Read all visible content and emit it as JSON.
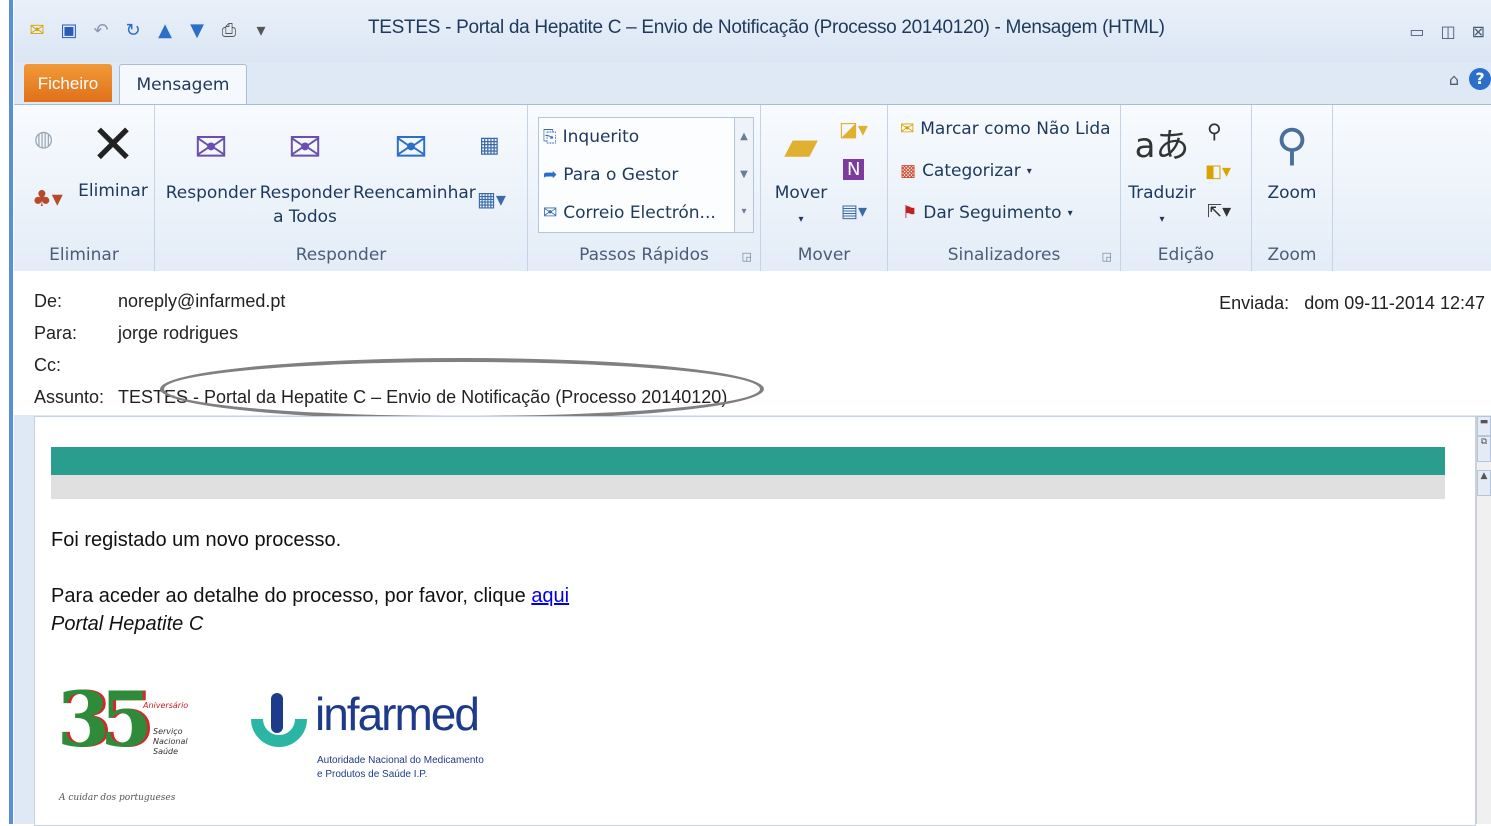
{
  "window": {
    "title": "TESTES - Portal da Hepatite C – Envio de Notificação (Processo 20140120)  -  Mensagem (HTML)"
  },
  "tabs": {
    "file": "Ficheiro",
    "message": "Mensagem"
  },
  "ribbon": {
    "groups": {
      "delete": "Eliminar",
      "respond": "Responder",
      "quicksteps": "Passos Rápidos",
      "move": "Mover",
      "tags": "Sinalizadores",
      "editing": "Edição",
      "zoom": "Zoom"
    },
    "buttons": {
      "delete": "Eliminar",
      "reply": "Responder",
      "reply_all_1": "Responder",
      "reply_all_2": "a Todos",
      "forward": "Reencaminhar",
      "move": "Mover",
      "translate": "Traduzir",
      "zoom": "Zoom"
    },
    "quicksteps": [
      "Inquerito",
      "Para o Gestor",
      "Correio Electrón..."
    ],
    "tags": {
      "mark_unread": "Marcar como Não Lida",
      "categorize": "Categorizar",
      "follow_up": "Dar Seguimento"
    }
  },
  "header": {
    "from_label": "De:",
    "from": "noreply@infarmed.pt",
    "to_label": "Para:",
    "to": "jorge rodrigues",
    "cc_label": "Cc:",
    "subject_label": "Assunto:",
    "subject": "TESTES - Portal da Hepatite C – Envio de Notificação (Processo 20140120)",
    "sent_label": "Enviada:",
    "sent": "dom 09-11-2014 12:47"
  },
  "message": {
    "line1": "Foi registado um novo processo.",
    "line2": "Para aceder ao detalhe do processo, por favor, clique ",
    "link": "aqui",
    "signature": "Portal Hepatite C",
    "logo35": {
      "number": "35",
      "anniv": "Aniversário",
      "sns1": "Serviço",
      "sns2": "Nacional",
      "sns3": "Saúde",
      "tagline": "A cuidar dos portugueses"
    },
    "infarmed": {
      "name": "infarmed",
      "sub1": "Autoridade Nacional do Medicamento",
      "sub2": "e Produtos de Saúde I.P."
    }
  },
  "colors": {
    "teal": "#2a9d8f",
    "accent_file_tab": "#e0701a",
    "link": "#0000ee"
  }
}
